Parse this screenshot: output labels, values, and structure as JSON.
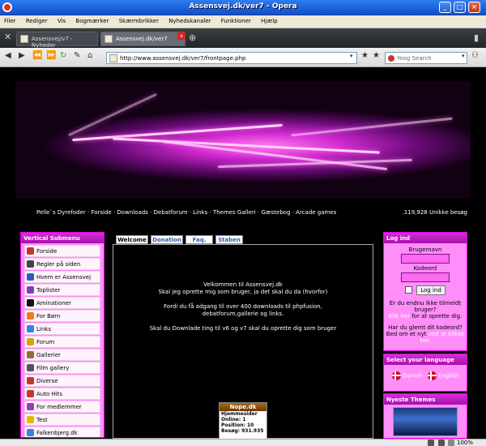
{
  "window": {
    "title": "Assensvej.dk/ver7 - Opera"
  },
  "menu": [
    "Filer",
    "Rediger",
    "Vis",
    "Bogmærker",
    "Skærmbrikker",
    "Nyhedskanaler",
    "Funktioner",
    "Hjælp"
  ],
  "tabs": [
    {
      "label": "Assensvej/v7 - Nyheder"
    },
    {
      "label": "Assensvej.dk/ver7"
    }
  ],
  "address": {
    "url": "http://www.assensvej.dk/ver7/frontpage.php"
  },
  "search": {
    "placeholder": "Yoog Search"
  },
  "site": {
    "nav": "Pelle`s Dyrefoder · Forside · Downloads · Debatforum · Links · Themes Galleri · Gæstebog · Arcade games",
    "visitors": ".119,928 Unikke besøg"
  },
  "left_panel": {
    "title": "Vertical Submenu",
    "items": [
      {
        "label": "Forside",
        "color": "#c0392b"
      },
      {
        "label": "Regler på siden",
        "color": "#444444"
      },
      {
        "label": "Hvem er Assensvej",
        "color": "#2e5cb8"
      },
      {
        "label": "Toplister",
        "color": "#7a3fb8"
      },
      {
        "label": "Aminationer",
        "color": "#111111"
      },
      {
        "label": "For Børn",
        "color": "#e67e22"
      },
      {
        "label": "Links",
        "color": "#2e86de"
      },
      {
        "label": "Forum",
        "color": "#d4a017"
      },
      {
        "label": "Gallerier",
        "color": "#8e6d3a"
      },
      {
        "label": "Film gallery",
        "color": "#555555"
      },
      {
        "label": "Diverse",
        "color": "#c0392b"
      },
      {
        "label": "Auto Hits",
        "color": "#c0392b"
      },
      {
        "label": "For medlemmer",
        "color": "#8e44ad"
      },
      {
        "label": "Test",
        "color": "#e6b800"
      },
      {
        "label": "Falkenbjerg.dk",
        "color": "#2e86de"
      }
    ]
  },
  "center": {
    "tabs": [
      "Welcome",
      "Donation",
      "Faq.",
      "Staben"
    ],
    "active_tab": "Welcome",
    "welcome_lines": [
      "Velkommen til Assensvej.dk",
      "Skal jeg oprette mig som bruger, ja det skal du da (hvorfor)",
      "",
      "Fordi du få adgang til over 400 downloads til phpfusion,",
      "debatforum,gallerie og links.",
      "",
      "Skal du Downlade ting til v6 og v7 skal du oprette dig som bruger"
    ]
  },
  "nope_widget": {
    "title": "Nope.dk",
    "rows": [
      "Hjemmesider",
      "Online:  1",
      "Position:  10",
      "Besøg:  931.935"
    ]
  },
  "login": {
    "title": "Log ind",
    "username_label": "Brugernavn",
    "password_label": "Kodeord",
    "button": "Log ind",
    "register_text": "Er du endnu ikke tilmeldt bruger?",
    "register_link": "Klik her",
    "register_suffix": "for at oprette dig.",
    "forgot_text": "Har du glemt dit kodeord? Bed om et nyt",
    "forgot_link": "ved at klikke her."
  },
  "language": {
    "title": "Select your language",
    "options": [
      "Danish",
      "English"
    ]
  },
  "themes": {
    "title": "Nyeste Themes"
  },
  "status": {
    "zoom": "100%"
  }
}
